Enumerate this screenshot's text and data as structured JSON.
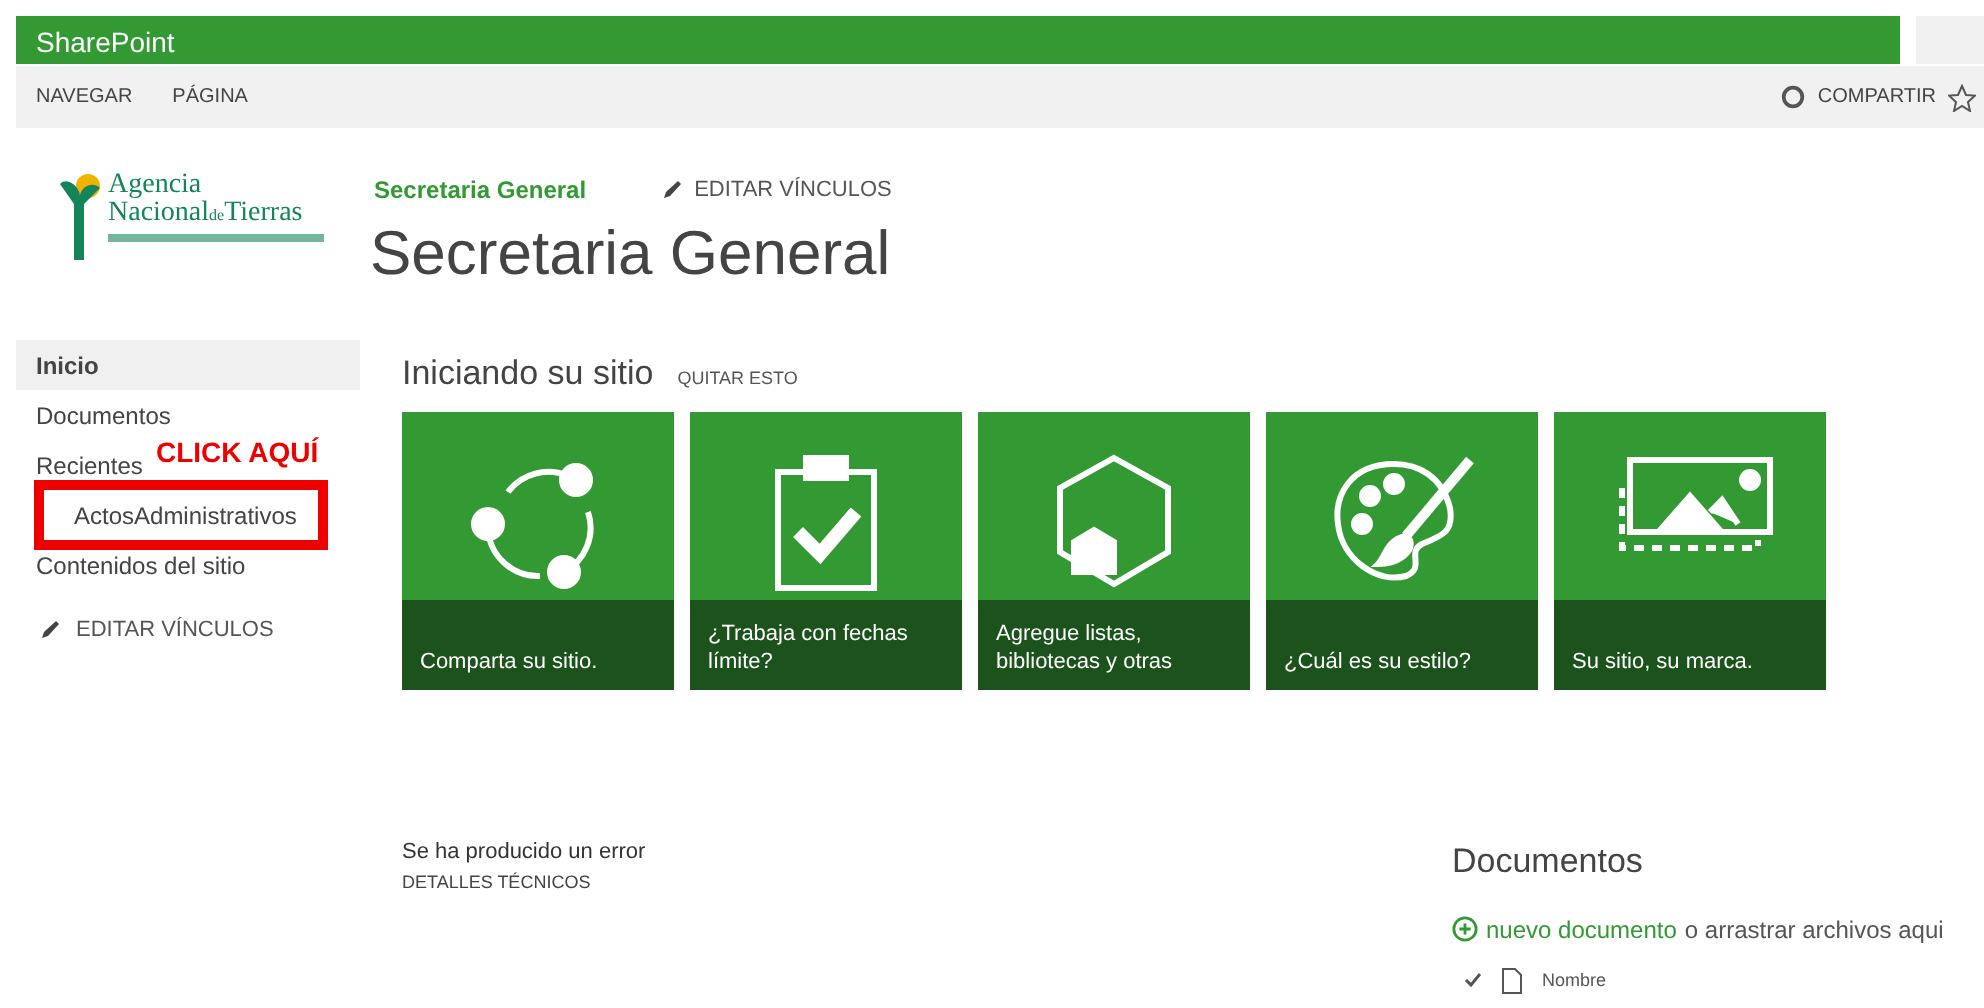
{
  "suite_bar": {
    "brand": "SharePoint"
  },
  "ribbon": {
    "tabs": [
      "NAVEGAR",
      "PÁGINA"
    ],
    "share": "COMPARTIR"
  },
  "logo": {
    "line_1": "Agencia",
    "line_2": "Nacional",
    "line_2_small": "de",
    "line_3": "Tierras"
  },
  "header": {
    "breadcrumb": "Secretaria General",
    "edit_links": "EDITAR VÍNCULOS",
    "title": "Secretaria General"
  },
  "sidebar": {
    "items": [
      {
        "label": "Inicio",
        "selected": true,
        "indented": false,
        "annotated": false
      },
      {
        "label": "Documentos",
        "selected": false,
        "indented": false,
        "annotated": false
      },
      {
        "label": "Recientes",
        "selected": false,
        "indented": false,
        "annotated": false
      },
      {
        "label": "ActosAdministrativos",
        "selected": false,
        "indented": true,
        "annotated": true
      },
      {
        "label": "Contenidos del sitio",
        "selected": false,
        "indented": false,
        "annotated": false
      }
    ],
    "edit_links": "EDITAR VÍNCULOS",
    "annotation": "CLICK AQUÍ"
  },
  "getting_started": {
    "title": "Iniciando su sitio",
    "dismiss": "QUITAR ESTO",
    "tiles": [
      {
        "kind": "share",
        "caption": "Comparta su sitio."
      },
      {
        "kind": "clipboard",
        "caption": "¿Trabaja con fechas límite?"
      },
      {
        "kind": "hexagon",
        "caption": "Agregue listas, bibliotecas y otras"
      },
      {
        "kind": "palette",
        "caption": "¿Cuál es su estilo?"
      },
      {
        "kind": "image",
        "caption": "Su sitio, su marca."
      }
    ]
  },
  "error": {
    "message": "Se ha producido un error",
    "details": "DETALLES TÉCNICOS"
  },
  "documents": {
    "title": "Documentos",
    "new_link": "nuevo documento",
    "drag_text": "o arrastrar archivos aqui",
    "column": "Nombre"
  }
}
